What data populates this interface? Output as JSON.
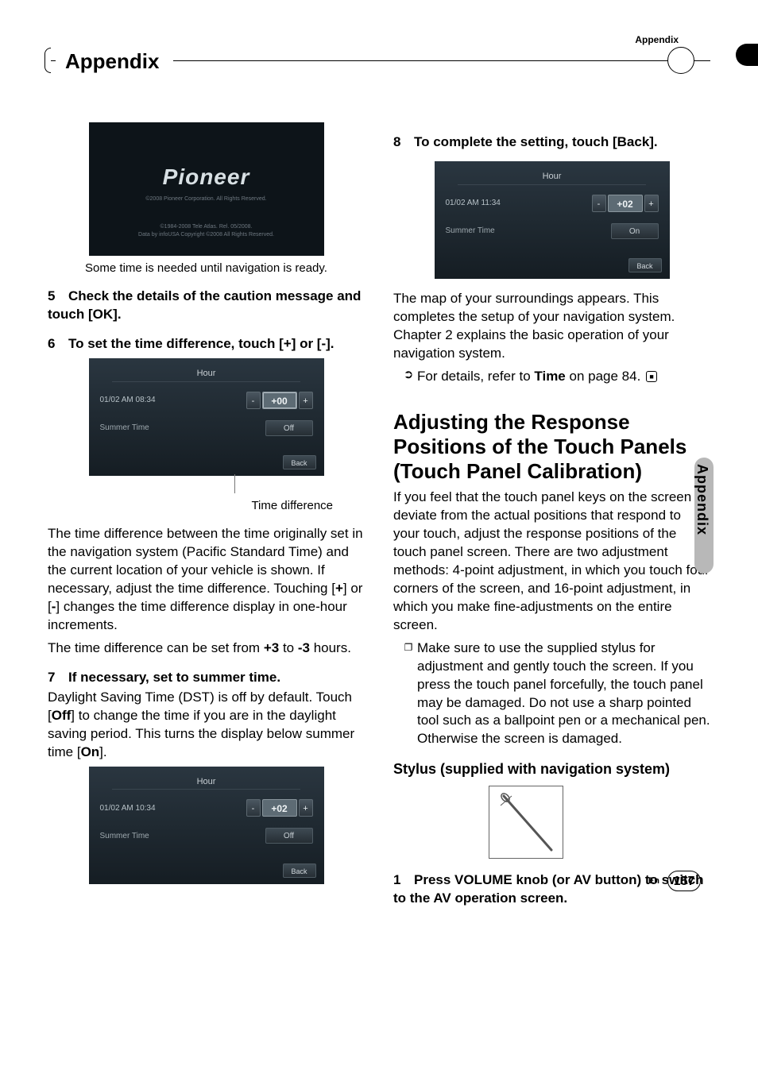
{
  "topRightLabel": "Appendix",
  "headerTitle": "Appendix",
  "sideTab": "Appendix",
  "splash": {
    "logo": "Pioneer",
    "line1": "©2008 Pioneer Corporation. All Rights Reserved.",
    "line2a": "©1984-2008 Tele Atlas. Rel. 05/2008.",
    "line2b": "Data by infoUSA Copyright ©2008 All Rights Reserved."
  },
  "caption1": "Some time is needed until navigation is ready.",
  "step5": "Check the details of the caution message and touch [OK].",
  "step6": "To set the time difference, touch [+] or [-].",
  "hour1": {
    "title": "Hour",
    "date": "01/02   AM  08:34",
    "minus": "-",
    "value": "+00",
    "plus": "+",
    "summerLabel": "Summer Time",
    "toggle": "Off",
    "back": "Back"
  },
  "timeDiffLabel": "Time difference",
  "para1": "The time difference between the time originally set in the navigation system (Pacific Standard Time) and the current location of your vehicle is shown. If necessary, adjust the time difference. Touching [",
  "para1_plus": "+",
  "para1_mid": "] or [",
  "para1_minus": "-",
  "para1_end": "] changes the time difference display in one-hour increments.",
  "para2a": "The time difference can be set from ",
  "para2_p3": "+3",
  "para2_mid": " to ",
  "para2_m3": "-3",
  "para2_end": " hours.",
  "step7": "If necessary, set to summer time.",
  "para3a": "Daylight Saving Time (DST) is off by default. Touch [",
  "para3_off": "Off",
  "para3b": "] to change the time if you are in the daylight saving period. This turns the display below summer time [",
  "para3_on": "On",
  "para3c": "].",
  "hour2": {
    "title": "Hour",
    "date": "01/02   AM  10:34",
    "minus": "-",
    "value": "+02",
    "plus": "+",
    "summerLabel": "Summer Time",
    "toggle": "Off",
    "back": "Back"
  },
  "step8": "To complete the setting, touch [Back].",
  "hour3": {
    "title": "Hour",
    "date": "01/02   AM  11:34",
    "minus": "-",
    "value": "+02",
    "plus": "+",
    "summerLabel": "Summer Time",
    "toggle": "On",
    "back": "Back"
  },
  "para4": "The map of your surroundings appears. This completes the setup of your navigation system. Chapter 2 explains the basic operation of your navigation system.",
  "ref1a": "For details, refer to ",
  "ref1b": "Time",
  "ref1c": " on page 84.",
  "sectionTitle": "Adjusting the Response Positions of the Touch Panels (Touch Panel Calibration)",
  "para5": "If you feel that the touch panel keys on the screen deviate from the actual positions that respond to your touch, adjust the response positions of the touch panel screen. There are two adjustment methods: 4-point adjustment, in which you touch four corners of the screen, and 16-point adjustment, in which you make fine-adjustments on the entire screen.",
  "bullet1": "Make sure to use the supplied stylus for adjustment and gently touch the screen. If you press the touch panel forcefully, the touch panel may be damaged. Do not use a sharp pointed tool such as a ballpoint pen or a mechanical pen. Otherwise the screen is damaged.",
  "stylusHead": "Stylus (supplied with navigation system)",
  "step1r": "Press VOLUME knob (or AV button) to switch to the AV operation screen.",
  "footerEn": "En",
  "pageNum": "157"
}
